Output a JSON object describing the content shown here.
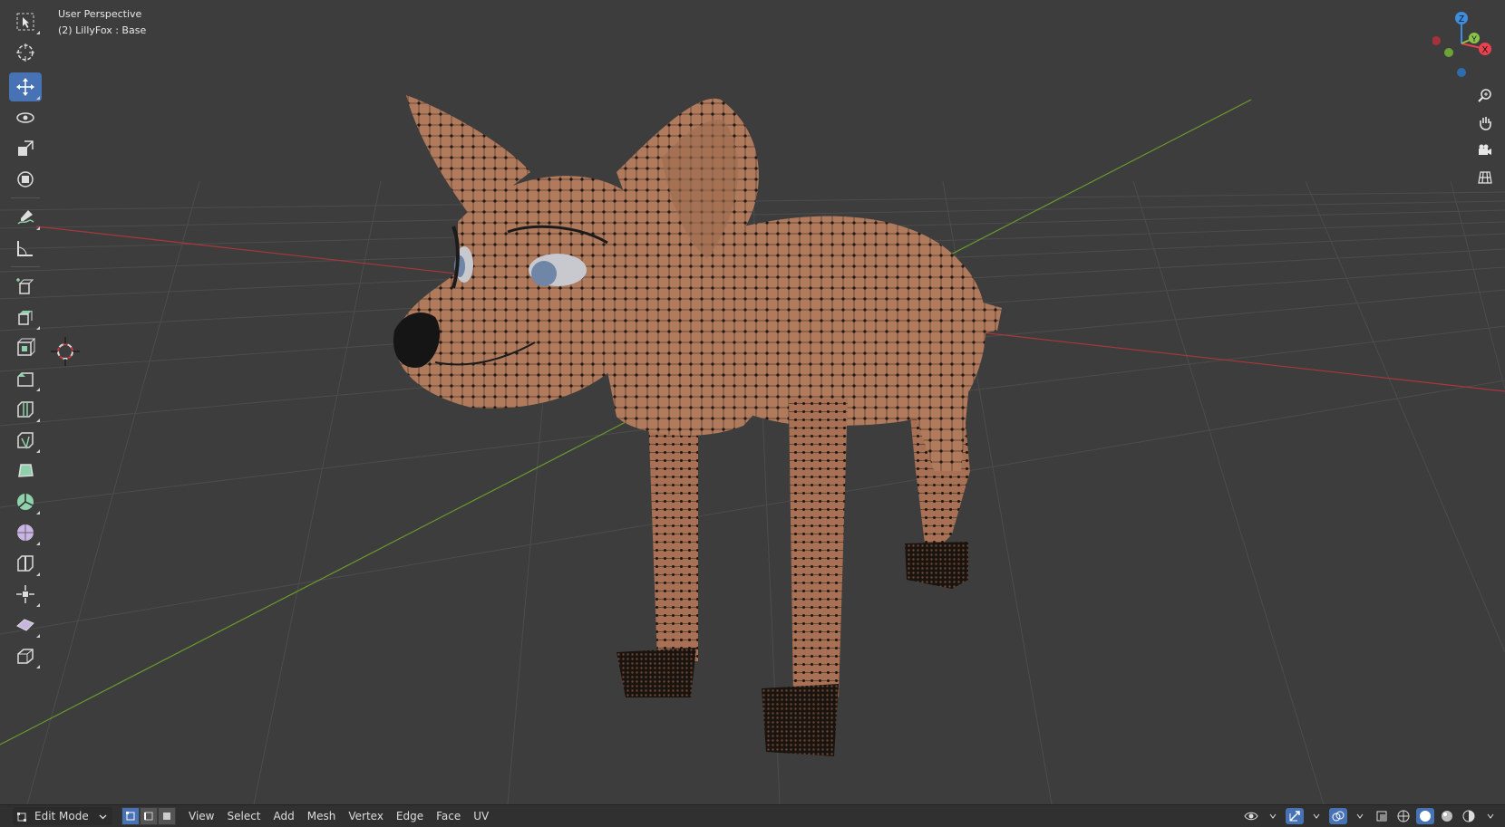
{
  "viewport": {
    "view_name": "User Perspective",
    "object_info": "(2) LillyFox : Base"
  },
  "toolbar": {
    "tools": [
      {
        "name": "select-box-tool",
        "icon": "select-box-icon",
        "active": false
      },
      {
        "name": "cursor-tool",
        "icon": "cursor-icon",
        "active": false
      },
      {
        "name": "move-tool",
        "icon": "move-icon",
        "active": true
      },
      {
        "name": "rotate-tool",
        "icon": "rotate-icon",
        "active": false
      },
      {
        "name": "scale-tool",
        "icon": "scale-icon",
        "active": false
      },
      {
        "name": "transform-tool",
        "icon": "transform-icon",
        "active": false
      },
      {
        "name": "annotate-tool",
        "icon": "annotate-icon",
        "active": false
      },
      {
        "name": "measure-tool",
        "icon": "measure-icon",
        "active": false
      },
      {
        "name": "add-cube-tool",
        "icon": "add-cube-icon",
        "active": false
      },
      {
        "name": "extrude-tool",
        "icon": "extrude-icon",
        "active": false
      },
      {
        "name": "inset-faces-tool",
        "icon": "inset-icon",
        "active": false
      },
      {
        "name": "bevel-tool",
        "icon": "bevel-icon",
        "active": false
      },
      {
        "name": "loop-cut-tool",
        "icon": "loop-cut-icon",
        "active": false
      },
      {
        "name": "knife-tool",
        "icon": "knife-icon",
        "active": false
      },
      {
        "name": "poly-build-tool",
        "icon": "poly-build-icon",
        "active": false
      },
      {
        "name": "spin-tool",
        "icon": "spin-icon",
        "active": false
      },
      {
        "name": "smooth-tool",
        "icon": "smooth-icon",
        "active": false
      },
      {
        "name": "edge-slide-tool",
        "icon": "edge-slide-icon",
        "active": false
      },
      {
        "name": "shrink-fatten-tool",
        "icon": "shrink-fatten-icon",
        "active": false
      },
      {
        "name": "shear-tool",
        "icon": "shear-icon",
        "active": false
      },
      {
        "name": "rip-region-tool",
        "icon": "rip-region-icon",
        "active": false
      }
    ]
  },
  "gizmo": {
    "x_label": "X",
    "y_label": "Y",
    "z_label": "Z",
    "x_color": "#e9424e",
    "y_color": "#8bc34a",
    "z_color": "#3e8ede"
  },
  "nav_buttons": [
    "zoom-icon",
    "pan-hand-icon",
    "camera-icon",
    "ortho-grid-icon"
  ],
  "header": {
    "mode": "Edit Mode",
    "menus": [
      "View",
      "Select",
      "Add",
      "Mesh",
      "Vertex",
      "Edge",
      "Face",
      "UV"
    ]
  },
  "colors": {
    "viewport_bg": "#3d3d3d",
    "header_bg": "#303030",
    "accent": "#4772b3",
    "mesh_skin": "#b07a5c",
    "x_axis_line": "#a8383c",
    "y_axis_line": "#6b9a2c"
  }
}
